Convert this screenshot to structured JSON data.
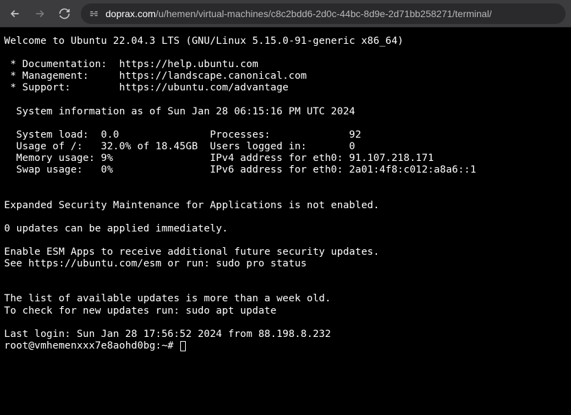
{
  "browser": {
    "url_domain": "doprax.com",
    "url_path": "/u/hemen/virtual-machines/c8c2bdd6-2d0c-44bc-8d9e-2d71bb258271/terminal/"
  },
  "terminal": {
    "welcome": "Welcome to Ubuntu 22.04.3 LTS (GNU/Linux 5.15.0-91-generic x86_64)",
    "links": {
      "doc_label": " * Documentation:  ",
      "doc_url": "https://help.ubuntu.com",
      "mgmt_label": " * Management:     ",
      "mgmt_url": "https://landscape.canonical.com",
      "support_label": " * Support:        ",
      "support_url": "https://ubuntu.com/advantage"
    },
    "sysinfo_header": "  System information as of Sun Jan 28 06:15:16 PM UTC 2024",
    "stats": {
      "line1": "  System load:  0.0               Processes:             92",
      "line2": "  Usage of /:   32.0% of 18.45GB  Users logged in:       0",
      "line3": "  Memory usage: 9%                IPv4 address for eth0: 91.107.218.171",
      "line4": "  Swap usage:   0%                IPv6 address for eth0: 2a01:4f8:c012:a8a6::1"
    },
    "esm1": "Expanded Security Maintenance for Applications is not enabled.",
    "updates": "0 updates can be applied immediately.",
    "esm2": "Enable ESM Apps to receive additional future security updates.",
    "esm3": "See https://ubuntu.com/esm or run: sudo pro status",
    "updatelist1": "The list of available updates is more than a week old.",
    "updatelist2": "To check for new updates run: sudo apt update",
    "lastlogin": "Last login: Sun Jan 28 17:56:52 2024 from 88.198.8.232",
    "prompt": "root@vmhemenxxx7e8aohd0bg:~# "
  }
}
